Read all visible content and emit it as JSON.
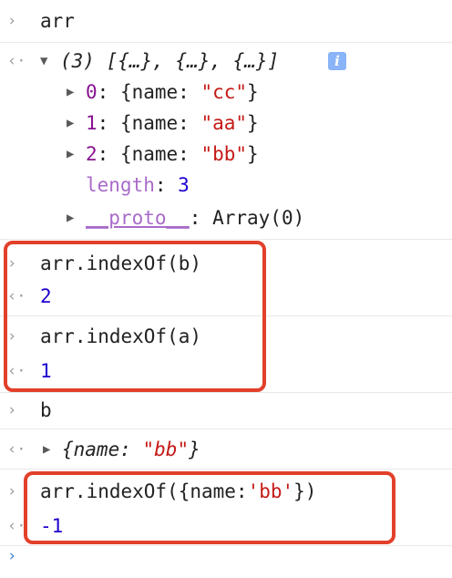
{
  "console": {
    "input_caret": "›",
    "output_caret": "‹·",
    "expand_glyph": "▶",
    "collapse_glyph": "▼",
    "entries": {
      "arr_cmd": "arr",
      "arr_summary": "(3) [{…}, {…}, {…}]",
      "info_badge": "i",
      "items": [
        {
          "key": "0",
          "prefix": ": {name: ",
          "value": "\"cc\"",
          "suffix": "}"
        },
        {
          "key": "1",
          "prefix": ": {name: ",
          "value": "\"aa\"",
          "suffix": "}"
        },
        {
          "key": "2",
          "prefix": ": {name: ",
          "value": "\"bb\"",
          "suffix": "}"
        }
      ],
      "length_key": "length",
      "length_sep": ": ",
      "length_value": "3",
      "proto_key": "__proto__",
      "proto_value": ": Array(0)",
      "cmd1": "arr.indexOf(b)",
      "res1": "2",
      "cmd2": "arr.indexOf(a)",
      "res2": "1",
      "cmd3": "b",
      "res3_prefix": "{name: ",
      "res3_value": "\"bb\"",
      "res3_suffix": "}",
      "cmd4_prefix": "arr.indexOf({name:",
      "cmd4_value": "'bb'",
      "cmd4_suffix": "})",
      "res4": "-1"
    }
  },
  "colors": {
    "highlight": "#e2402a",
    "number": "#1c00cf",
    "string": "#c41a16",
    "property": "#881391"
  }
}
